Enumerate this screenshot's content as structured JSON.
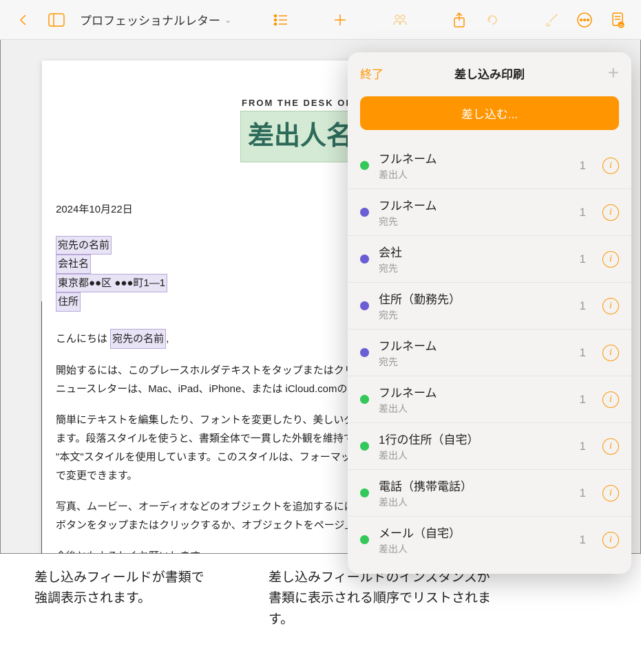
{
  "toolbar": {
    "doc_title": "プロフェッショナルレター"
  },
  "document": {
    "from_desk": "FROM THE DESK OF",
    "sender_name": "差出人名",
    "date": "2024年10月22日",
    "addr": {
      "recipient": "宛先の名前",
      "company": "会社名",
      "city": "東京都●●区 ●●●町1—1",
      "street": "住所"
    },
    "greeting_prefix": "こんにちは ",
    "greeting_field": "宛先の名前",
    "greeting_suffix": ",",
    "para1": "開始するには、このプレースホルダテキストをタップまたはクリックして、入力を始めます。この\nニュースレターは、Mac、iPad、iPhone、または iCloud.comのPagesで編集できます。",
    "para2": "簡単にテキストを編集したり、フォントを変更したり、美しいグラフィックスを追加したりでき\nます。段落スタイルを使うと、書類全体で一貫した外観を維持できます。例えば、この段落は\n\"本文\"スタイルを使用しています。このスタイルは、フォーマットサイドバーまたはインスペクタ\nで変更できます。",
    "para3": "写真、ムービー、オーディオなどのオブジェクトを追加するには、ツールバーでそれぞれ該当する\nボタンをタップまたはクリックするか、オブジェクトをページ上にドラッグ＆ドロップします。",
    "closing": "今後ともよろしくお願いします。"
  },
  "popover": {
    "done": "終了",
    "title": "差し込み印刷",
    "merge_btn": "差し込む...",
    "fields": [
      {
        "name": "フルネーム",
        "sub": "差出人",
        "count": "1",
        "dot": "green"
      },
      {
        "name": "フルネーム",
        "sub": "宛先",
        "count": "1",
        "dot": "purple"
      },
      {
        "name": "会社",
        "sub": "宛先",
        "count": "1",
        "dot": "purple"
      },
      {
        "name": "住所（勤務先）",
        "sub": "宛先",
        "count": "1",
        "dot": "purple"
      },
      {
        "name": "フルネーム",
        "sub": "宛先",
        "count": "1",
        "dot": "purple"
      },
      {
        "name": "フルネーム",
        "sub": "差出人",
        "count": "1",
        "dot": "green"
      },
      {
        "name": "1行の住所（自宅）",
        "sub": "差出人",
        "count": "1",
        "dot": "green"
      },
      {
        "name": "電話（携帯電話）",
        "sub": "差出人",
        "count": "1",
        "dot": "green"
      },
      {
        "name": "メール（自宅）",
        "sub": "差出人",
        "count": "1",
        "dot": "green"
      }
    ]
  },
  "callouts": {
    "left": "差し込みフィールドが書類で強調表示されます。",
    "right": "差し込みフィールドのインスタンスが書類に表示される順序でリストされます。"
  }
}
